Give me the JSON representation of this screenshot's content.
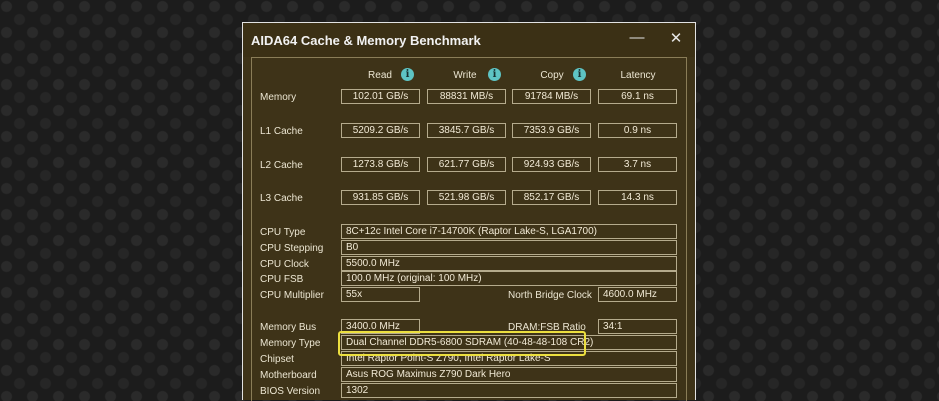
{
  "window": {
    "title": "AIDA64 Cache & Memory Benchmark",
    "minimize_glyph": "—",
    "close_glyph": "✕"
  },
  "columns": {
    "read": "Read",
    "write": "Write",
    "copy": "Copy",
    "latency": "Latency",
    "info_glyph": "i"
  },
  "rows": [
    {
      "label": "Memory",
      "read": "102.01 GB/s",
      "write": "88831 MB/s",
      "copy": "91784 MB/s",
      "latency": "69.1 ns"
    },
    {
      "label": "L1 Cache",
      "read": "5209.2 GB/s",
      "write": "3845.7 GB/s",
      "copy": "7353.9 GB/s",
      "latency": "0.9 ns"
    },
    {
      "label": "L2 Cache",
      "read": "1273.8 GB/s",
      "write": "621.77 GB/s",
      "copy": "924.93 GB/s",
      "latency": "3.7 ns"
    },
    {
      "label": "L3 Cache",
      "read": "931.85 GB/s",
      "write": "521.98 GB/s",
      "copy": "852.17 GB/s",
      "latency": "14.3 ns"
    }
  ],
  "cpu": {
    "type_label": "CPU Type",
    "type_value": "8C+12c Intel Core i7-14700K  (Raptor Lake-S, LGA1700)",
    "stepping_label": "CPU Stepping",
    "stepping_value": "B0",
    "clock_label": "CPU Clock",
    "clock_value": "5500.0 MHz",
    "fsb_label": "CPU FSB",
    "fsb_value": "100.0 MHz  (original: 100 MHz)",
    "multiplier_label": "CPU Multiplier",
    "multiplier_value": "55x",
    "nb_clock_label": "North Bridge Clock",
    "nb_clock_value": "4600.0 MHz"
  },
  "memory": {
    "bus_label": "Memory Bus",
    "bus_value": "3400.0 MHz",
    "ratio_label": "DRAM:FSB Ratio",
    "ratio_value": "34:1",
    "type_label": "Memory Type",
    "type_value": "Dual Channel DDR5-6800 SDRAM  (40-48-48-108 CR2)",
    "chipset_label": "Chipset",
    "chipset_value": "Intel Raptor Point-S Z790, Intel Raptor Lake-S",
    "motherboard_label": "Motherboard",
    "motherboard_value": "Asus ROG Maximus Z790 Dark Hero",
    "bios_label": "BIOS Version",
    "bios_value": "1302"
  }
}
